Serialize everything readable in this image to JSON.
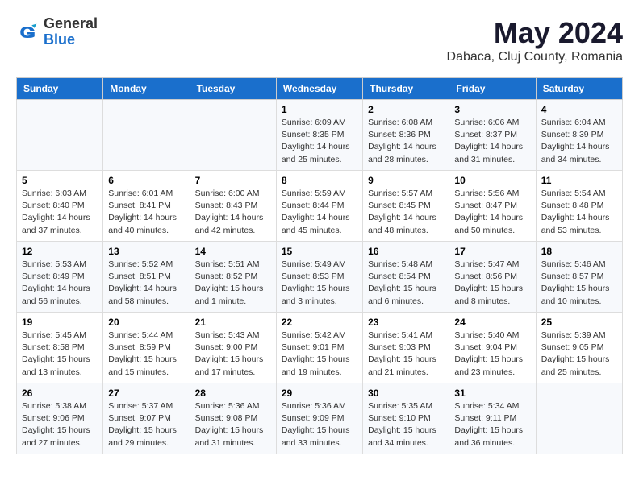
{
  "logo": {
    "general": "General",
    "blue": "Blue"
  },
  "title": "May 2024",
  "subtitle": "Dabaca, Cluj County, Romania",
  "days_header": [
    "Sunday",
    "Monday",
    "Tuesday",
    "Wednesday",
    "Thursday",
    "Friday",
    "Saturday"
  ],
  "weeks": [
    [
      {
        "num": "",
        "info": ""
      },
      {
        "num": "",
        "info": ""
      },
      {
        "num": "",
        "info": ""
      },
      {
        "num": "1",
        "info": "Sunrise: 6:09 AM\nSunset: 8:35 PM\nDaylight: 14 hours\nand 25 minutes."
      },
      {
        "num": "2",
        "info": "Sunrise: 6:08 AM\nSunset: 8:36 PM\nDaylight: 14 hours\nand 28 minutes."
      },
      {
        "num": "3",
        "info": "Sunrise: 6:06 AM\nSunset: 8:37 PM\nDaylight: 14 hours\nand 31 minutes."
      },
      {
        "num": "4",
        "info": "Sunrise: 6:04 AM\nSunset: 8:39 PM\nDaylight: 14 hours\nand 34 minutes."
      }
    ],
    [
      {
        "num": "5",
        "info": "Sunrise: 6:03 AM\nSunset: 8:40 PM\nDaylight: 14 hours\nand 37 minutes."
      },
      {
        "num": "6",
        "info": "Sunrise: 6:01 AM\nSunset: 8:41 PM\nDaylight: 14 hours\nand 40 minutes."
      },
      {
        "num": "7",
        "info": "Sunrise: 6:00 AM\nSunset: 8:43 PM\nDaylight: 14 hours\nand 42 minutes."
      },
      {
        "num": "8",
        "info": "Sunrise: 5:59 AM\nSunset: 8:44 PM\nDaylight: 14 hours\nand 45 minutes."
      },
      {
        "num": "9",
        "info": "Sunrise: 5:57 AM\nSunset: 8:45 PM\nDaylight: 14 hours\nand 48 minutes."
      },
      {
        "num": "10",
        "info": "Sunrise: 5:56 AM\nSunset: 8:47 PM\nDaylight: 14 hours\nand 50 minutes."
      },
      {
        "num": "11",
        "info": "Sunrise: 5:54 AM\nSunset: 8:48 PM\nDaylight: 14 hours\nand 53 minutes."
      }
    ],
    [
      {
        "num": "12",
        "info": "Sunrise: 5:53 AM\nSunset: 8:49 PM\nDaylight: 14 hours\nand 56 minutes."
      },
      {
        "num": "13",
        "info": "Sunrise: 5:52 AM\nSunset: 8:51 PM\nDaylight: 14 hours\nand 58 minutes."
      },
      {
        "num": "14",
        "info": "Sunrise: 5:51 AM\nSunset: 8:52 PM\nDaylight: 15 hours\nand 1 minute."
      },
      {
        "num": "15",
        "info": "Sunrise: 5:49 AM\nSunset: 8:53 PM\nDaylight: 15 hours\nand 3 minutes."
      },
      {
        "num": "16",
        "info": "Sunrise: 5:48 AM\nSunset: 8:54 PM\nDaylight: 15 hours\nand 6 minutes."
      },
      {
        "num": "17",
        "info": "Sunrise: 5:47 AM\nSunset: 8:56 PM\nDaylight: 15 hours\nand 8 minutes."
      },
      {
        "num": "18",
        "info": "Sunrise: 5:46 AM\nSunset: 8:57 PM\nDaylight: 15 hours\nand 10 minutes."
      }
    ],
    [
      {
        "num": "19",
        "info": "Sunrise: 5:45 AM\nSunset: 8:58 PM\nDaylight: 15 hours\nand 13 minutes."
      },
      {
        "num": "20",
        "info": "Sunrise: 5:44 AM\nSunset: 8:59 PM\nDaylight: 15 hours\nand 15 minutes."
      },
      {
        "num": "21",
        "info": "Sunrise: 5:43 AM\nSunset: 9:00 PM\nDaylight: 15 hours\nand 17 minutes."
      },
      {
        "num": "22",
        "info": "Sunrise: 5:42 AM\nSunset: 9:01 PM\nDaylight: 15 hours\nand 19 minutes."
      },
      {
        "num": "23",
        "info": "Sunrise: 5:41 AM\nSunset: 9:03 PM\nDaylight: 15 hours\nand 21 minutes."
      },
      {
        "num": "24",
        "info": "Sunrise: 5:40 AM\nSunset: 9:04 PM\nDaylight: 15 hours\nand 23 minutes."
      },
      {
        "num": "25",
        "info": "Sunrise: 5:39 AM\nSunset: 9:05 PM\nDaylight: 15 hours\nand 25 minutes."
      }
    ],
    [
      {
        "num": "26",
        "info": "Sunrise: 5:38 AM\nSunset: 9:06 PM\nDaylight: 15 hours\nand 27 minutes."
      },
      {
        "num": "27",
        "info": "Sunrise: 5:37 AM\nSunset: 9:07 PM\nDaylight: 15 hours\nand 29 minutes."
      },
      {
        "num": "28",
        "info": "Sunrise: 5:36 AM\nSunset: 9:08 PM\nDaylight: 15 hours\nand 31 minutes."
      },
      {
        "num": "29",
        "info": "Sunrise: 5:36 AM\nSunset: 9:09 PM\nDaylight: 15 hours\nand 33 minutes."
      },
      {
        "num": "30",
        "info": "Sunrise: 5:35 AM\nSunset: 9:10 PM\nDaylight: 15 hours\nand 34 minutes."
      },
      {
        "num": "31",
        "info": "Sunrise: 5:34 AM\nSunset: 9:11 PM\nDaylight: 15 hours\nand 36 minutes."
      },
      {
        "num": "",
        "info": ""
      }
    ]
  ]
}
